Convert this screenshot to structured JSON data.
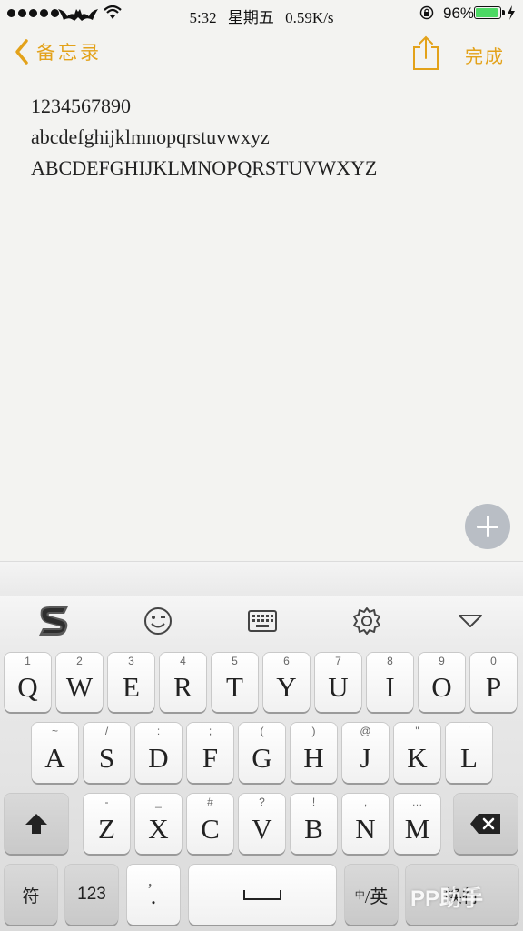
{
  "status_bar": {
    "time": "5:32",
    "weekday": "星期五",
    "network_speed": "0.59K/s",
    "battery_percent": "96%",
    "battery_level": 0.96,
    "carrier_logo": "bat-logo",
    "wifi_icon": "wifi-icon"
  },
  "navbar": {
    "back_label": "备忘录",
    "done_label": "完成",
    "share_icon": "share-icon",
    "accent_color": "#e3a21a"
  },
  "note": {
    "lines": [
      "1234567890",
      "abcdefghijklmnopqrstuvwxyz",
      "ABCDEFGHIJKLMNOPQRSTUVWXYZ"
    ]
  },
  "keyboard": {
    "toolbar_icons": [
      "sogou-logo",
      "emoji-icon",
      "keyboard-icon",
      "settings-icon",
      "collapse-icon"
    ],
    "row1": [
      {
        "main": "Q",
        "sub": "1"
      },
      {
        "main": "W",
        "sub": "2"
      },
      {
        "main": "E",
        "sub": "3"
      },
      {
        "main": "R",
        "sub": "4"
      },
      {
        "main": "T",
        "sub": "5"
      },
      {
        "main": "Y",
        "sub": "6"
      },
      {
        "main": "U",
        "sub": "7"
      },
      {
        "main": "I",
        "sub": "8"
      },
      {
        "main": "O",
        "sub": "9"
      },
      {
        "main": "P",
        "sub": "0"
      }
    ],
    "row2": [
      {
        "main": "A",
        "sub": "~"
      },
      {
        "main": "S",
        "sub": "/"
      },
      {
        "main": "D",
        "sub": ":"
      },
      {
        "main": "F",
        "sub": ";"
      },
      {
        "main": "G",
        "sub": "("
      },
      {
        "main": "H",
        "sub": ")"
      },
      {
        "main": "J",
        "sub": "@"
      },
      {
        "main": "K",
        "sub": "\""
      },
      {
        "main": "L",
        "sub": "'"
      }
    ],
    "row3": [
      {
        "main": "Z",
        "sub": "-"
      },
      {
        "main": "X",
        "sub": "_"
      },
      {
        "main": "C",
        "sub": "#"
      },
      {
        "main": "V",
        "sub": "?"
      },
      {
        "main": "B",
        "sub": "!"
      },
      {
        "main": "N",
        "sub": ","
      },
      {
        "main": "M",
        "sub": "…"
      }
    ],
    "bottom": {
      "symbols_label": "符",
      "numbers_label": "123",
      "punct_main": ".",
      "punct_sub": "，",
      "lang_sub": "中",
      "lang_label": "/英",
      "return_label": "换行"
    }
  },
  "watermark": "PP助手"
}
